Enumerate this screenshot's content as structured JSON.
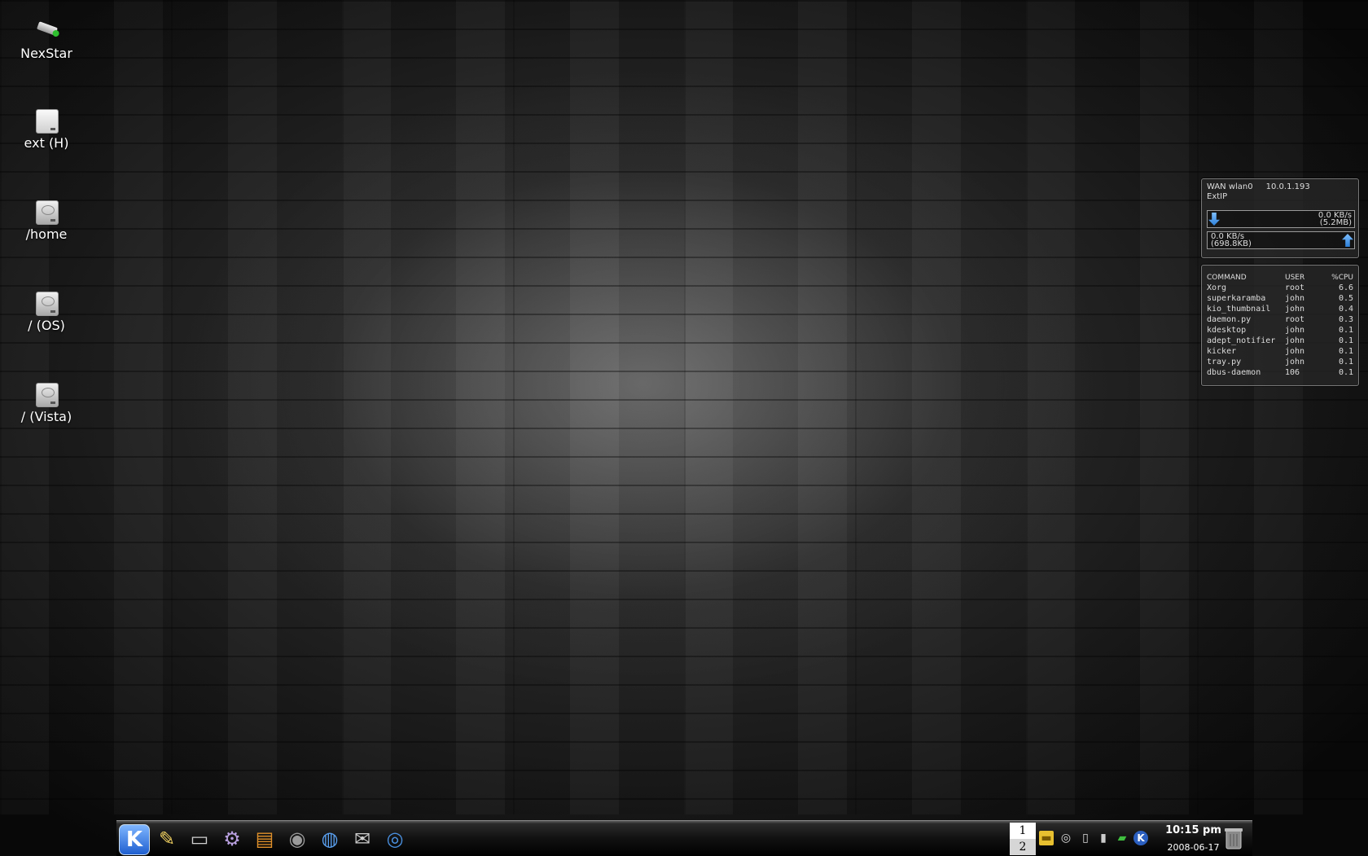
{
  "desktop": {
    "icons": [
      {
        "label": "NexStar",
        "icon": "usb-drive-icon"
      },
      {
        "label": "ext (H)",
        "icon": "removable-drive-icon"
      },
      {
        "label": "/home",
        "icon": "hard-drive-icon"
      },
      {
        "label": "/ (OS)",
        "icon": "hard-drive-icon"
      },
      {
        "label": "/ (Vista)",
        "icon": "hard-drive-icon"
      }
    ]
  },
  "network_widget": {
    "interface": "WAN wlan0",
    "ip": "10.0.1.193",
    "ext_label": "ExtIP",
    "download": {
      "rate": "0.0 KB/s",
      "total": "(5.2MB)"
    },
    "upload": {
      "rate": "0.0 KB/s",
      "total": "(698.8KB)"
    }
  },
  "process_widget": {
    "headers": [
      "COMMAND",
      "USER",
      "%CPU"
    ],
    "rows": [
      [
        "Xorg",
        "root",
        "6.6"
      ],
      [
        "superkaramba",
        "john",
        "0.5"
      ],
      [
        "kio_thumbnail",
        "john",
        "0.4"
      ],
      [
        "daemon.py",
        "root",
        "0.3"
      ],
      [
        "kdesktop",
        "john",
        "0.1"
      ],
      [
        "adept_notifier",
        "john",
        "0.1"
      ],
      [
        "kicker",
        "john",
        "0.1"
      ],
      [
        "tray.py",
        "john",
        "0.1"
      ],
      [
        "dbus-daemon",
        "106",
        "0.1"
      ]
    ]
  },
  "taskbar": {
    "kmenu_label": "K",
    "launchers": [
      {
        "icon": "kate-editor-icon",
        "glyph": "✎"
      },
      {
        "icon": "terminal-icon",
        "glyph": "▭"
      },
      {
        "icon": "settings-icon",
        "glyph": "⚙"
      },
      {
        "icon": "file-manager-icon",
        "glyph": "▤"
      },
      {
        "icon": "media-player-icon",
        "glyph": "◉"
      },
      {
        "icon": "web-browser-icon",
        "glyph": "◍"
      },
      {
        "icon": "mail-icon",
        "glyph": "✉"
      },
      {
        "icon": "network-globe-icon",
        "glyph": "◎"
      }
    ],
    "pager": [
      "1",
      "2"
    ],
    "tray": [
      {
        "icon": "notes-icon",
        "glyph": "▬"
      },
      {
        "icon": "optical-drive-icon",
        "glyph": "◎"
      },
      {
        "icon": "clipboard-icon",
        "glyph": "▯"
      },
      {
        "icon": "system-monitor-icon",
        "glyph": "▮"
      },
      {
        "icon": "battery-icon",
        "glyph": "▰"
      },
      {
        "icon": "kde-updates-icon",
        "glyph": "K"
      }
    ],
    "clock_time": "10:15 pm",
    "clock_date": "2008-06-17",
    "colors": {
      "tray_notes": "#e8c030",
      "battery": "#3fbf3f",
      "accent": "#2b7fd8"
    }
  }
}
